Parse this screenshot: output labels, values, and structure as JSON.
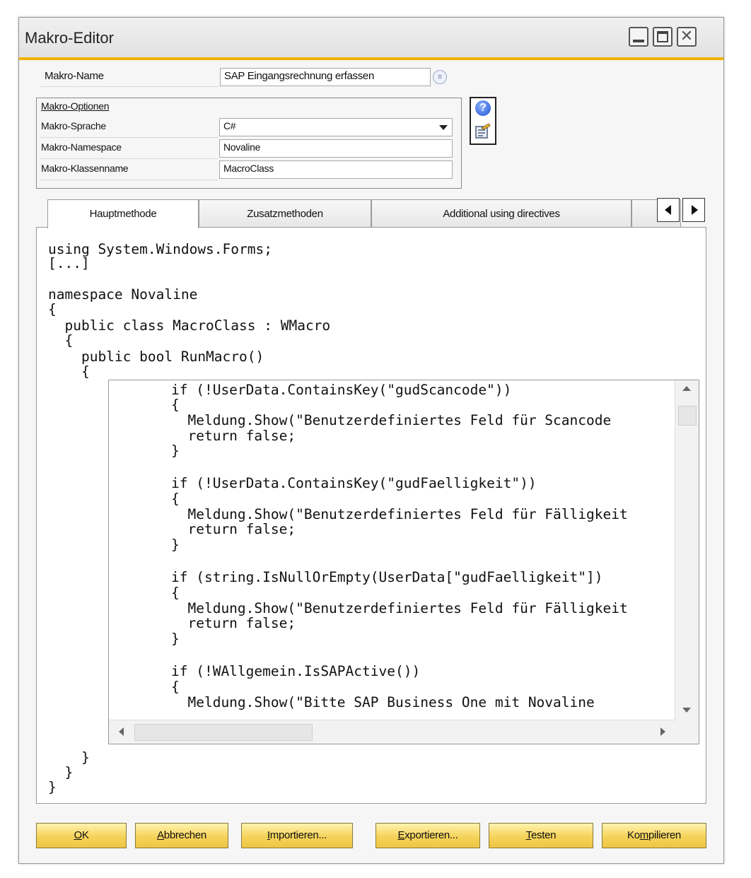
{
  "window": {
    "title": "Makro-Editor"
  },
  "macro": {
    "name_label": "Makro-Name",
    "name_value": "SAP Eingangsrechnung erfassen"
  },
  "options": {
    "group_label": "Makro-Optionen",
    "language_label": "Makro-Sprache",
    "language_value": "C#",
    "namespace_label": "Makro-Namespace",
    "namespace_value": "Novaline",
    "class_label": "Makro-Klassenname",
    "class_value": "MacroClass"
  },
  "tabs": [
    {
      "label": "Hauptmethode",
      "active": true
    },
    {
      "label": "Zusatzmethoden",
      "active": false
    },
    {
      "label": "Additional using directives",
      "active": false
    }
  ],
  "code_outer": {
    "l1": "using System.Windows.Forms;",
    "l2": "[...]",
    "l3": "namespace Novaline",
    "l4": "{",
    "l5": "  public class MacroClass : WMacro",
    "l6": "  {",
    "l7": "    public bool RunMacro()",
    "l8": "    {",
    "l9": "    }",
    "l10": "  }",
    "l11": "}"
  },
  "code_inner": {
    "l1": "if (!UserData.ContainsKey(\"gudScancode\"))",
    "l2": "{",
    "l3": "  Meldung.Show(\"Benutzerdefiniertes Feld für Scancode",
    "l4": "  return false;",
    "l5": "}",
    "l6": "if (!UserData.ContainsKey(\"gudFaelligkeit\"))",
    "l7": "{",
    "l8": "  Meldung.Show(\"Benutzerdefiniertes Feld für Fälligkeit",
    "l9": "  return false;",
    "l10": "}",
    "l11": "if (string.IsNullOrEmpty(UserData[\"gudFaelligkeit\"])",
    "l12": "{",
    "l13": "  Meldung.Show(\"Benutzerdefiniertes Feld für Fälligkeit",
    "l14": "  return false;",
    "l15": "}",
    "l16": "if (!WAllgemein.IsSAPActive())",
    "l17": "{",
    "l18": "  Meldung.Show(\"Bitte SAP Business One mit Novaline"
  },
  "buttons": {
    "ok": {
      "underlined": "O",
      "rest": "K"
    },
    "cancel": {
      "underlined": "A",
      "rest": "bbrechen"
    },
    "import": {
      "underlined": "I",
      "rest": "mportieren..."
    },
    "export": {
      "underlined": "E",
      "rest": "xportieren..."
    },
    "test": {
      "underlined": "T",
      "rest": "esten"
    },
    "compile_pre": "Ko",
    "compile_underlined": "m",
    "compile_rest": "pilieren"
  },
  "colors": {
    "accent": "#f0b400",
    "button": "#f5d35a"
  },
  "icons": [
    "minimize-icon",
    "maximize-icon",
    "close-icon",
    "list-icon",
    "dropdown-arrow-icon",
    "help-icon",
    "properties-icon",
    "arrow-left-icon",
    "arrow-right-icon"
  ]
}
